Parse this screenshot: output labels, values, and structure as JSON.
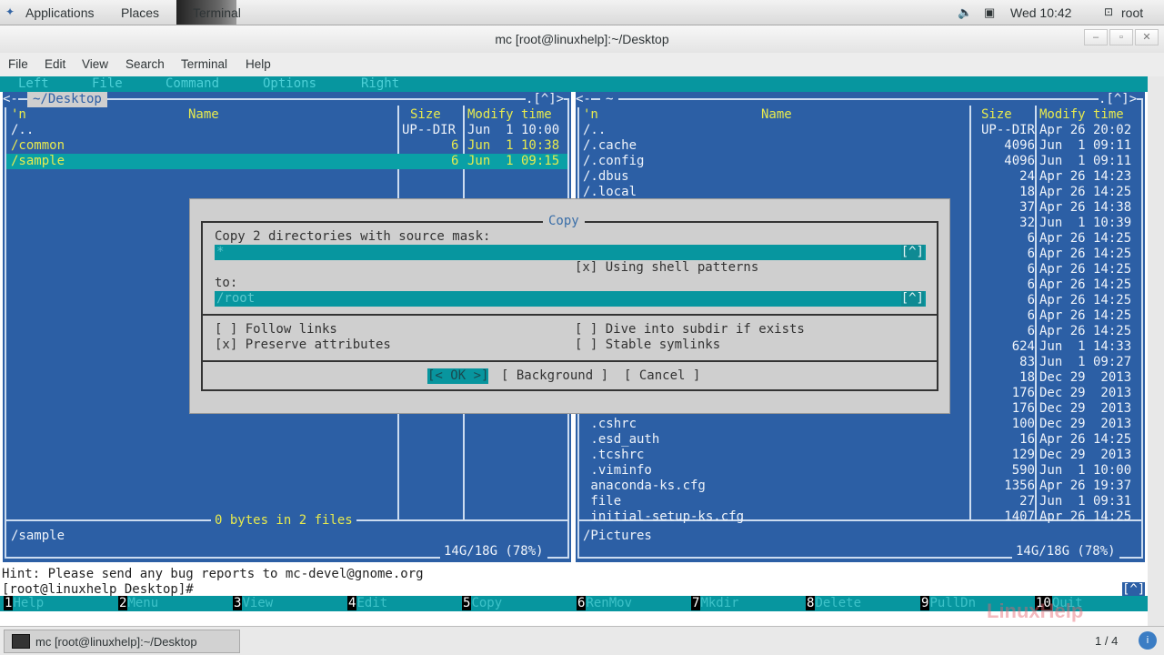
{
  "topbar": {
    "applications": "Applications",
    "places": "Places",
    "terminal": "Terminal",
    "clock": "Wed 10:42",
    "user": "root",
    "volume_icon": "volume-icon",
    "network_icon": "network-icon"
  },
  "window": {
    "title": "mc [root@linuxhelp]:~/Desktop"
  },
  "menubar": [
    "File",
    "Edit",
    "View",
    "Search",
    "Terminal",
    "Help"
  ],
  "mc_menu": [
    "Left",
    "File",
    "Command",
    "Options",
    "Right"
  ],
  "left_panel": {
    "path": "~/Desktop",
    "corner": ".[^]>",
    "col_n": "'n",
    "col_name": "Name",
    "col_size": "Size",
    "col_time": "Modify time",
    "files": [
      {
        "name": "/..",
        "size": "UP--DIR",
        "time": "Jun  1 10:00"
      },
      {
        "name": "/common",
        "size": "6",
        "time": "Jun  1 10:38"
      },
      {
        "name": "/sample",
        "size": "6",
        "time": "Jun  1 09:15"
      }
    ],
    "summary": "0 bytes in 2 files",
    "status": "/sample",
    "disk": "14G/18G (78%)"
  },
  "right_panel": {
    "path": "~",
    "corner": ".[^]>",
    "col_n": "'n",
    "col_name": "Name",
    "col_size": "Size",
    "col_time": "Modify time",
    "files": [
      {
        "name": "/..",
        "size": "UP--DIR",
        "time": "Apr 26 20:02"
      },
      {
        "name": "/.cache",
        "size": "4096",
        "time": "Jun  1 09:11"
      },
      {
        "name": "/.config",
        "size": "4096",
        "time": "Jun  1 09:11"
      },
      {
        "name": "/.dbus",
        "size": "24",
        "time": "Apr 26 14:23"
      },
      {
        "name": "/.local",
        "size": "18",
        "time": "Apr 26 14:25"
      },
      {
        "name": "",
        "size": "37",
        "time": "Apr 26 14:38"
      },
      {
        "name": "",
        "size": "32",
        "time": "Jun  1 10:39"
      },
      {
        "name": "",
        "size": "6",
        "time": "Apr 26 14:25"
      },
      {
        "name": "",
        "size": "6",
        "time": "Apr 26 14:25"
      },
      {
        "name": "",
        "size": "6",
        "time": "Apr 26 14:25"
      },
      {
        "name": "",
        "size": "6",
        "time": "Apr 26 14:25"
      },
      {
        "name": "",
        "size": "6",
        "time": "Apr 26 14:25"
      },
      {
        "name": "",
        "size": "6",
        "time": "Apr 26 14:25"
      },
      {
        "name": "",
        "size": "6",
        "time": "Apr 26 14:25"
      },
      {
        "name": "",
        "size": "624",
        "time": "Jun  1 14:33"
      },
      {
        "name": "",
        "size": "83",
        "time": "Jun  1 09:27"
      },
      {
        "name": "",
        "size": "18",
        "time": "Dec 29  2013"
      },
      {
        "name": "",
        "size": "176",
        "time": "Dec 29  2013"
      },
      {
        "name": "",
        "size": "176",
        "time": "Dec 29  2013"
      },
      {
        "name": " .cshrc",
        "size": "100",
        "time": "Dec 29  2013"
      },
      {
        "name": " .esd_auth",
        "size": "16",
        "time": "Apr 26 14:25"
      },
      {
        "name": " .tcshrc",
        "size": "129",
        "time": "Dec 29  2013"
      },
      {
        "name": " .viminfo",
        "size": "590",
        "time": "Jun  1 10:00"
      },
      {
        "name": " anaconda-ks.cfg",
        "size": "1356",
        "time": "Apr 26 19:37"
      },
      {
        "name": " file",
        "size": "27",
        "time": "Jun  1 09:31"
      },
      {
        "name": " initial-setup-ks.cfg",
        "size": "1407",
        "time": "Apr 26 14:25"
      }
    ],
    "status": "/Pictures",
    "disk": "14G/18G (78%)"
  },
  "copy_dialog": {
    "title": "Copy",
    "source_label": "Copy 2 directories with source mask:",
    "source_value": "*",
    "history_btn": "[^]",
    "shell_patterns": "[x] Using shell patterns",
    "to_label": "to:",
    "to_value": "/root",
    "follow_links": "[ ] Follow links",
    "preserve_attrs": "[x] Preserve attributes",
    "dive_subdir": "[ ] Dive into subdir if exists",
    "stable_symlinks": "[ ] Stable symlinks",
    "ok": "[< OK >]",
    "background": "[ Background ]",
    "cancel": "[ Cancel ]"
  },
  "hint": "Hint: Please send any bug reports to mc-devel@gnome.org",
  "prompt": "[root@linuxhelp Desktop]#",
  "prompt_btn": "[^]",
  "fkeys": [
    {
      "num": "1",
      "label": "Help"
    },
    {
      "num": "2",
      "label": "Menu"
    },
    {
      "num": "3",
      "label": "View"
    },
    {
      "num": "4",
      "label": "Edit"
    },
    {
      "num": "5",
      "label": "Copy"
    },
    {
      "num": "6",
      "label": "RenMov"
    },
    {
      "num": "7",
      "label": "Mkdir"
    },
    {
      "num": "8",
      "label": "Delete"
    },
    {
      "num": "9",
      "label": "PullDn"
    },
    {
      "num": "10",
      "label": "Quit"
    }
  ],
  "taskbar": {
    "task": "mc [root@linuxhelp]:~/Desktop",
    "workspace": "1 / 4",
    "watermark": "LinuxHelp"
  }
}
